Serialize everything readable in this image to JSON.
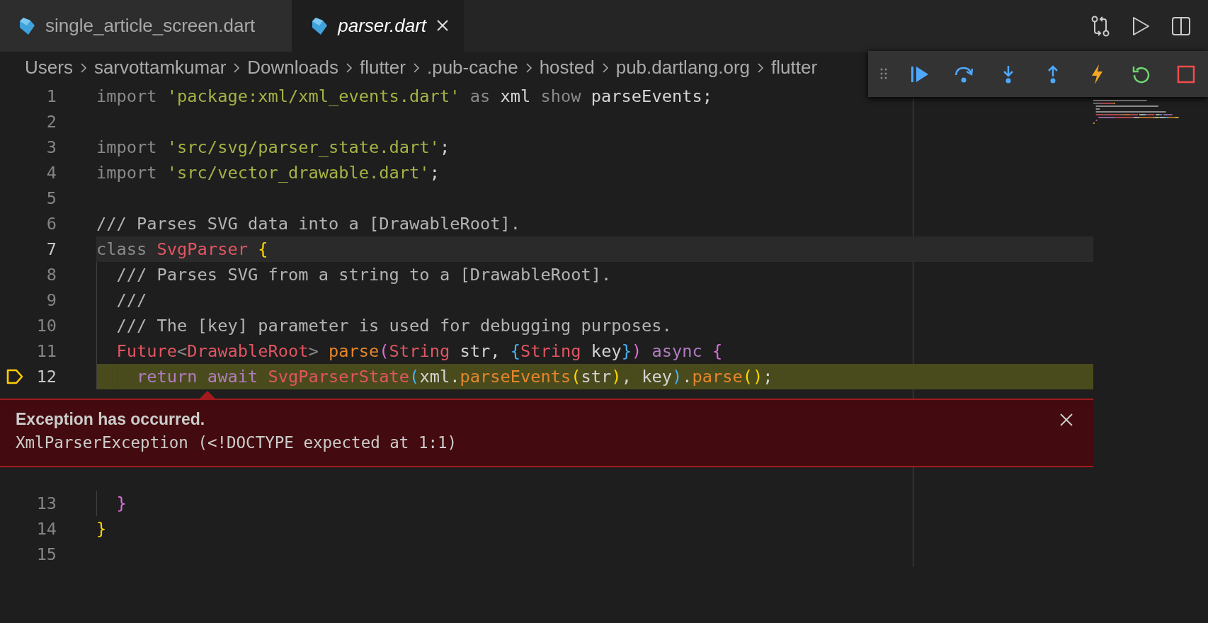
{
  "tabs": [
    {
      "label": "single_article_screen.dart",
      "selected": false,
      "preview": false
    },
    {
      "label": "parser.dart",
      "selected": true,
      "preview": true
    }
  ],
  "breadcrumb": [
    "Users",
    "sarvottamkumar",
    "Downloads",
    "flutter",
    ".pub-cache",
    "hosted",
    "pub.dartlang.org",
    "flutter"
  ],
  "lines": [
    {
      "number": "1",
      "kind": "normal",
      "tokens": [
        {
          "kind": "keyword",
          "text": "import "
        },
        {
          "kind": "string",
          "text": "'package:xml/xml_events.dart'"
        },
        {
          "kind": "keyword",
          "text": " as "
        },
        {
          "kind": "plain",
          "text": "xml "
        },
        {
          "kind": "keyword",
          "text": "show "
        },
        {
          "kind": "plain",
          "text": "parseEvents;"
        }
      ]
    },
    {
      "number": "2",
      "kind": "normal"
    },
    {
      "number": "3",
      "kind": "normal",
      "tokens": [
        {
          "kind": "keyword",
          "text": "import "
        },
        {
          "kind": "string",
          "text": "'src/svg/parser_state.dart'"
        },
        {
          "kind": "plain",
          "text": ";"
        }
      ]
    },
    {
      "number": "4",
      "kind": "normal",
      "tokens": [
        {
          "kind": "keyword",
          "text": "import "
        },
        {
          "kind": "string",
          "text": "'src/vector_drawable.dart'"
        },
        {
          "kind": "plain",
          "text": ";"
        }
      ]
    },
    {
      "number": "5",
      "kind": "normal"
    },
    {
      "number": "6",
      "kind": "normal",
      "tokens": [
        {
          "kind": "comment",
          "text": "/// Parses SVG data into a [DrawableRoot]."
        }
      ]
    },
    {
      "number": "7",
      "kind": "cursor",
      "tokens": [
        {
          "kind": "keyword",
          "text": "class "
        },
        {
          "kind": "type",
          "text": "SvgParser "
        },
        {
          "kind": "bracket1",
          "text": "{"
        }
      ]
    },
    {
      "number": "8",
      "kind": "normal",
      "tokens": [
        {
          "kind": "comment",
          "text": "  /// Parses SVG from a string to a [DrawableRoot]."
        }
      ]
    },
    {
      "number": "9",
      "kind": "normal",
      "tokens": [
        {
          "kind": "comment",
          "text": "  ///"
        }
      ]
    },
    {
      "number": "10",
      "kind": "normal",
      "tokens": [
        {
          "kind": "comment",
          "text": "  /// The [key] parameter is used for debugging purposes."
        }
      ]
    },
    {
      "number": "11",
      "kind": "normal",
      "tokens": [
        {
          "kind": "type",
          "text": "  Future"
        },
        {
          "kind": "punct",
          "text": "<"
        },
        {
          "kind": "type",
          "text": "DrawableRoot"
        },
        {
          "kind": "punct",
          "text": "> "
        },
        {
          "kind": "function",
          "text": "parse"
        },
        {
          "kind": "bracket2",
          "text": "("
        },
        {
          "kind": "type",
          "text": "String"
        },
        {
          "kind": "plain",
          "text": " str, "
        },
        {
          "kind": "bracket3",
          "text": "{"
        },
        {
          "kind": "type",
          "text": "String"
        },
        {
          "kind": "plain",
          "text": " key"
        },
        {
          "kind": "bracket3",
          "text": "}"
        },
        {
          "kind": "bracket2",
          "text": ")"
        },
        {
          "kind": "control",
          "text": " async "
        },
        {
          "kind": "bracket2",
          "text": "{"
        }
      ]
    },
    {
      "number": "12",
      "kind": "paused",
      "tokens": [
        {
          "kind": "control",
          "text": "    return await "
        },
        {
          "kind": "type",
          "text": "SvgParserState"
        },
        {
          "kind": "bracket3",
          "text": "("
        },
        {
          "kind": "plain",
          "text": "xml."
        },
        {
          "kind": "function",
          "text": "parseEvents"
        },
        {
          "kind": "bracket1",
          "text": "("
        },
        {
          "kind": "plain",
          "text": "str"
        },
        {
          "kind": "bracket1",
          "text": ")"
        },
        {
          "kind": "plain",
          "text": ", key"
        },
        {
          "kind": "bracket3",
          "text": ")"
        },
        {
          "kind": "plain",
          "text": "."
        },
        {
          "kind": "function",
          "text": "parse"
        },
        {
          "kind": "bracket1",
          "text": "()"
        },
        {
          "kind": "plain",
          "text": ";"
        }
      ],
      "exception": {
        "title": "Exception has occurred.",
        "message": "XmlParserException (<!DOCTYPE expected at 1:1)"
      }
    },
    {
      "number": "13",
      "kind": "normal",
      "tokens": [
        {
          "kind": "bracket2",
          "text": "  }"
        }
      ]
    },
    {
      "number": "14",
      "kind": "normal",
      "tokens": [
        {
          "kind": "bracket1",
          "text": "}"
        }
      ]
    },
    {
      "number": "15",
      "kind": "normal"
    }
  ]
}
